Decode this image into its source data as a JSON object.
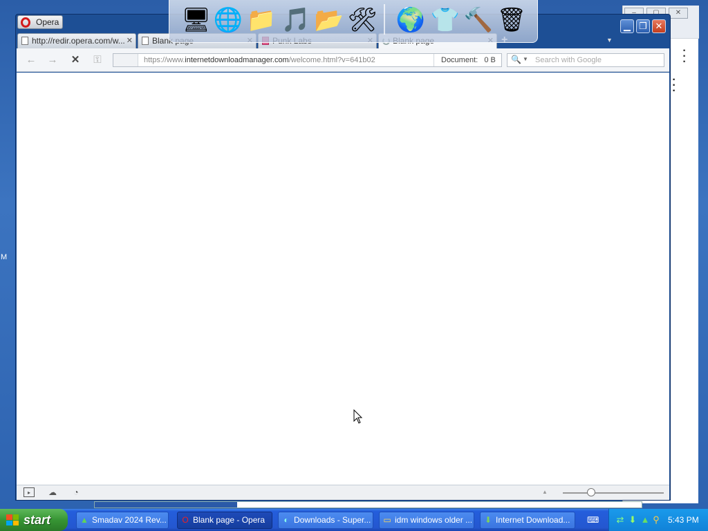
{
  "opera": {
    "menu_label": "Opera",
    "tabs": [
      {
        "label": "http://redir.opera.com/w..."
      },
      {
        "label": "Blank page"
      },
      {
        "label": "Punk Labs"
      },
      {
        "label": "Blank page"
      }
    ],
    "address": {
      "prefix": "https://www.",
      "domain": "internetdownloadmanager.com",
      "path": "/welcome.html?v=641b02",
      "document_label": "Document:",
      "document_size": "0 B"
    },
    "search_placeholder": "Search with Google",
    "zoom_percent": 40
  },
  "background_window": {
    "side_letter": "M"
  },
  "taskbar": {
    "start_label": "start",
    "tasks": [
      {
        "label": "Smadav 2024 Rev...",
        "icon": "smadav-icon"
      },
      {
        "label": "Blank page - Opera",
        "icon": "opera-icon"
      },
      {
        "label": "Downloads - Super...",
        "icon": "browser-icon"
      },
      {
        "label": "idm windows older ...",
        "icon": "folder-icon"
      },
      {
        "label": "Internet Download...",
        "icon": "idm-icon"
      }
    ],
    "clock": "5:43 PM"
  },
  "strip_progress": 0.26,
  "colors": {
    "opera_frame": "#1d4f95",
    "taskbar": "#2457d0",
    "start_green": "#379534",
    "tray": "#1182d8"
  }
}
